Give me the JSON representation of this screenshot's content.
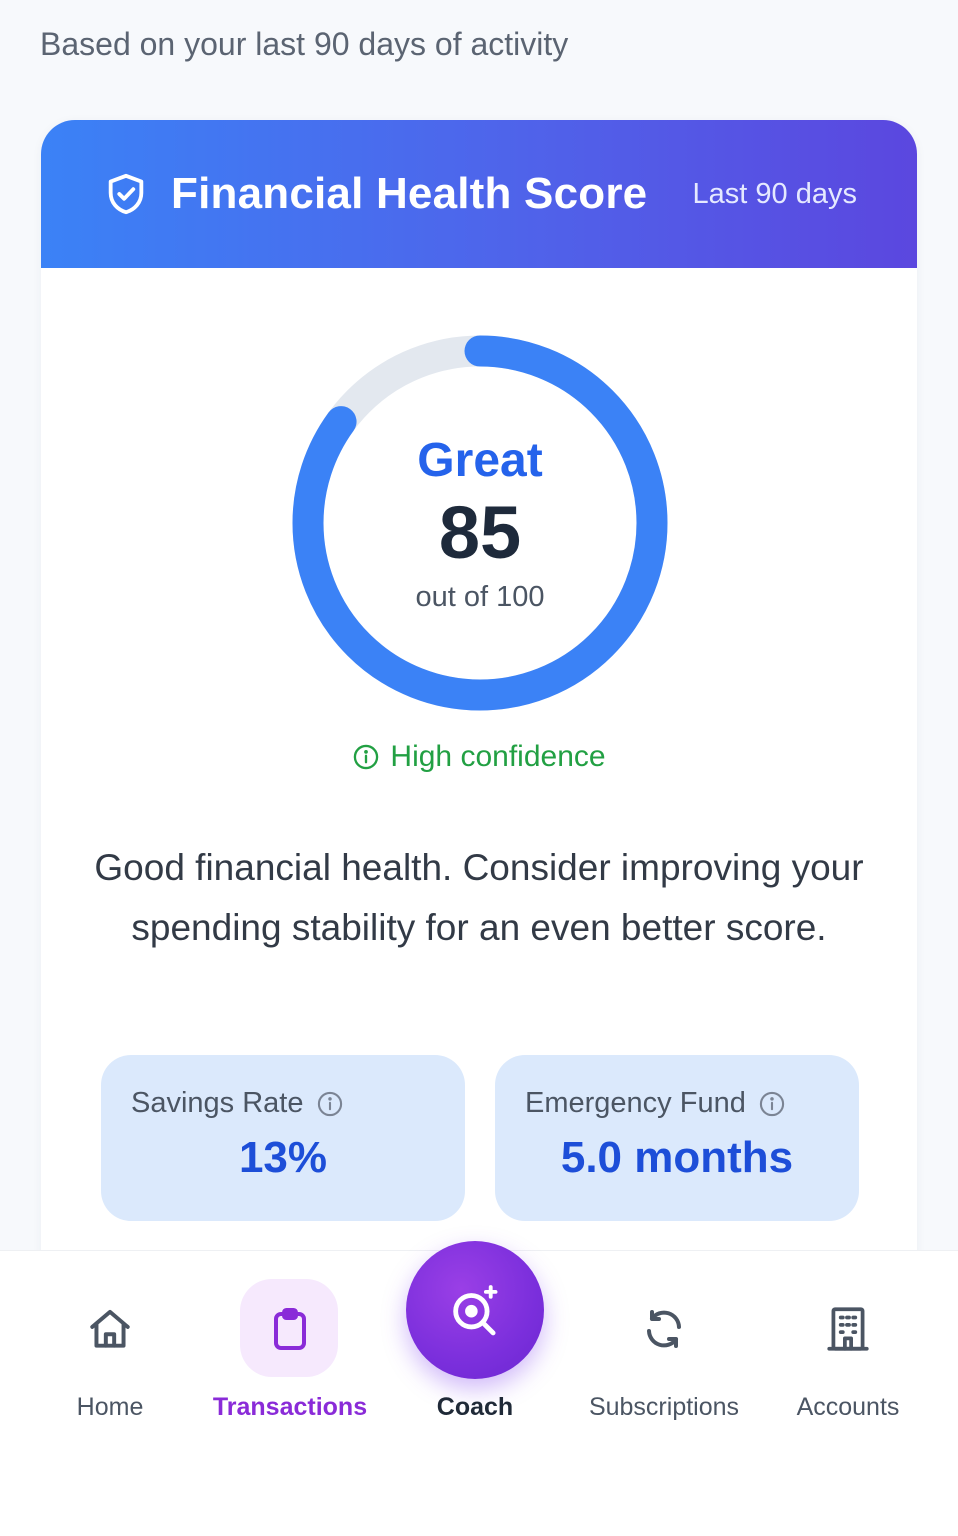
{
  "subtitle": "Based on your last 90 days of activity",
  "card": {
    "title": "Financial Health Score",
    "range": "Last 90 days",
    "accent_start": "#3b82f6",
    "accent_end": "#5b47df"
  },
  "score": {
    "label": "Great",
    "value": "85",
    "out_of": "out of 100",
    "fraction": 0.85,
    "ring_color": "#3b82f6",
    "track_color": "#e3e8ef"
  },
  "confidence": {
    "text": "High confidence",
    "icon": "info-circle-icon",
    "color": "#22a043"
  },
  "summary": "Good financial health. Consider improving your spending stability for an even better score.",
  "metrics": [
    {
      "label": "Savings Rate",
      "value": "13%",
      "icon": "info-circle-icon"
    },
    {
      "label": "Emergency Fund",
      "value": "5.0 months",
      "icon": "info-circle-icon"
    }
  ],
  "nav": {
    "active": "Transactions",
    "active_color": "#8a2bd8",
    "items": [
      {
        "label": "Home",
        "icon": "home-icon"
      },
      {
        "label": "Transactions",
        "icon": "clipboard-icon"
      },
      {
        "label": "Coach",
        "icon": "sparkle-search-icon"
      },
      {
        "label": "Subscriptions",
        "icon": "refresh-icon"
      },
      {
        "label": "Accounts",
        "icon": "building-icon"
      }
    ]
  }
}
